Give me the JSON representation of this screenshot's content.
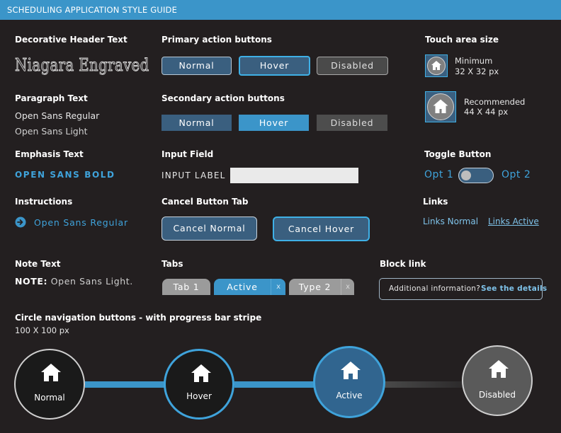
{
  "header": {
    "title": "SCHEDULING APPLICATION STYLE GUIDE"
  },
  "decorative": {
    "heading": "Decorative Header Text",
    "sample": "Niagara Engraved"
  },
  "paragraph": {
    "heading": "Paragraph Text",
    "regular": "Open Sans Regular",
    "light": "Open Sans Light"
  },
  "emphasis": {
    "heading": "Emphasis Text",
    "sample": "OPEN SANS BOLD"
  },
  "instructions": {
    "heading": "Instructions",
    "text": "Open Sans Regular"
  },
  "note": {
    "heading": "Note Text",
    "label": "NOTE:",
    "text": "Open Sans Light."
  },
  "primary": {
    "heading": "Primary action buttons",
    "normal": "Normal",
    "hover": "Hover",
    "disabled": "Disabled"
  },
  "secondary": {
    "heading": "Secondary action buttons",
    "normal": "Normal",
    "hover": "Hover",
    "disabled": "Disabled"
  },
  "input": {
    "heading": "Input Field",
    "label": "INPUT LABEL",
    "value": ""
  },
  "cancel": {
    "heading": "Cancel Button Tab",
    "normal": "Cancel Normal",
    "hover": "Cancel Hover"
  },
  "tabs": {
    "heading": "Tabs",
    "tab1": "Tab 1",
    "active": "Active",
    "type2": "Type 2",
    "close": "x"
  },
  "touch": {
    "heading": "Touch area size",
    "min_label": "Minimum",
    "min_size": "32 X 32 px",
    "rec_label": "Recommended",
    "rec_size": "44 X 44 px"
  },
  "toggle": {
    "heading": "Toggle Button",
    "opt1": "Opt 1",
    "opt2": "Opt 2"
  },
  "links": {
    "heading": "Links",
    "normal": "Links Normal",
    "active": "Links Active"
  },
  "block": {
    "heading": "Block link",
    "text": "Additional information?",
    "link": "See the details"
  },
  "circles": {
    "heading": "Circle navigation buttons - with progress bar stripe",
    "size": "100 X 100 px",
    "normal": "Normal",
    "hover": "Hover",
    "active": "Active",
    "disabled": "Disabled"
  },
  "colors": {
    "accent": "#3b95c9",
    "background": "#231f20",
    "primary_fill": "#3a5f7f",
    "hover_border": "#3fb0e6",
    "disabled": "#4a4a4a"
  },
  "icons": [
    "home-icon",
    "arrow-right-circle-icon",
    "close-icon"
  ]
}
